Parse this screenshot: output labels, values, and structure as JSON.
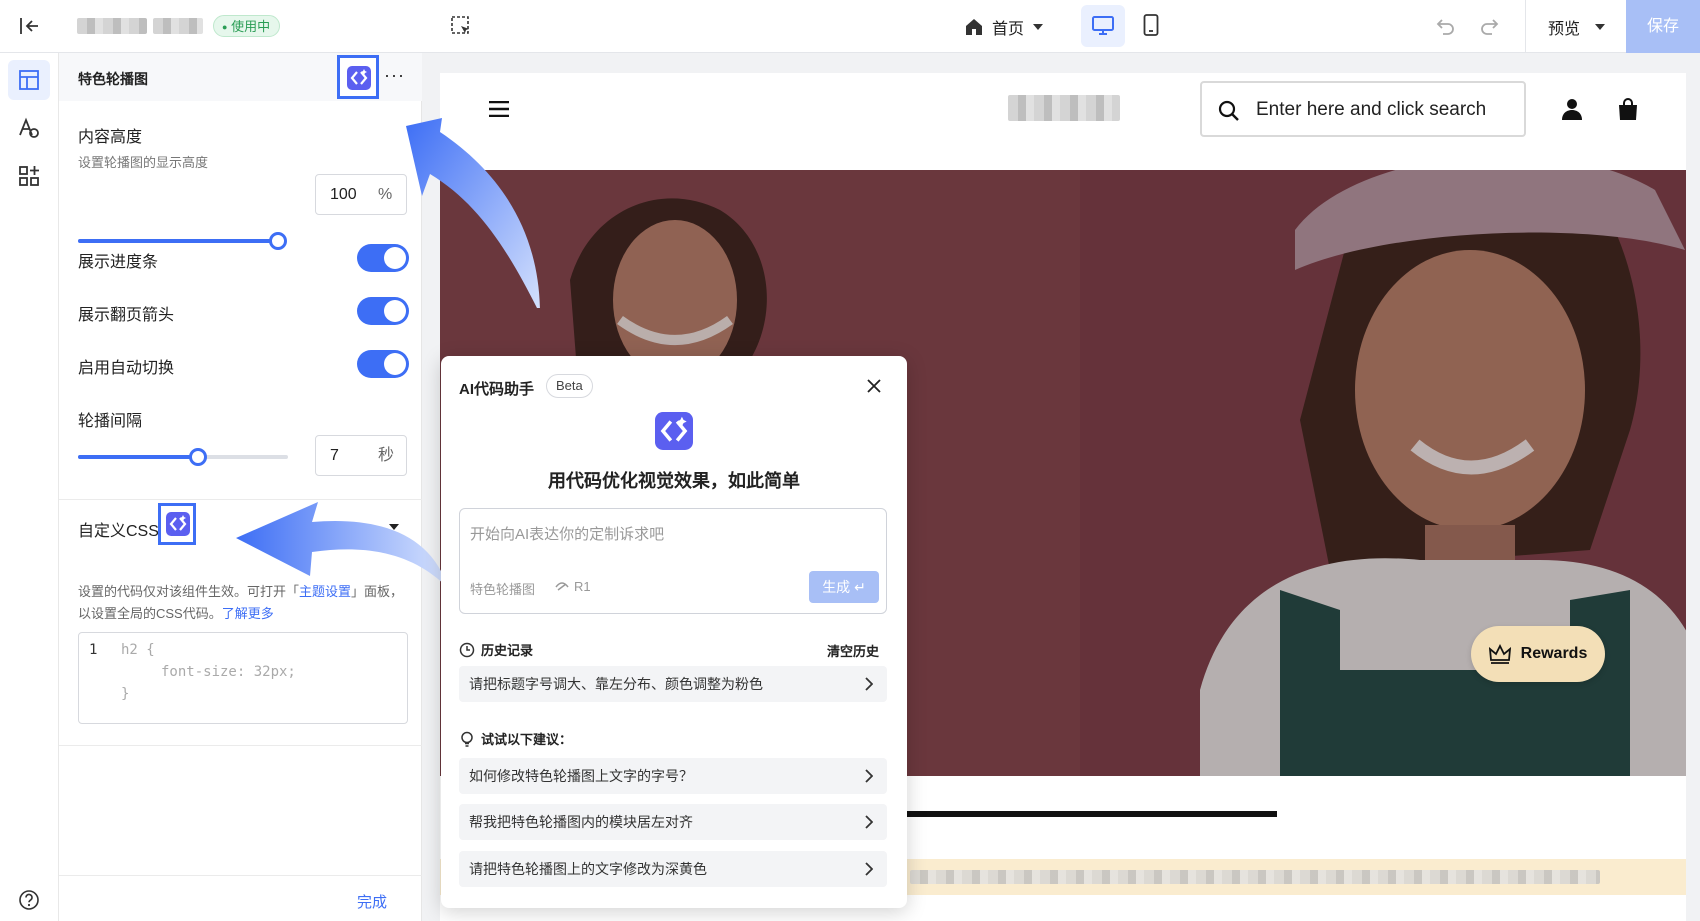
{
  "topbar": {
    "status_badge": "使用中",
    "page_select": "首页",
    "preview_label": "预览",
    "save_label": "保存"
  },
  "panel": {
    "section_title": "特色轮播图",
    "more": "···",
    "height_label": "内容高度",
    "height_desc": "设置轮播图的显示高度",
    "height_value": "100",
    "height_unit": "%",
    "height_slider_fraction": 1.0,
    "show_progress": "展示进度条",
    "show_arrows": "展示翻页箭头",
    "auto_switch": "启用自动切换",
    "interval_label": "轮播间隔",
    "interval_value": "7",
    "interval_unit": "秒",
    "interval_slider_fraction": 0.57,
    "css_title": "自定义CSS",
    "css_desc_1": "设置的代码仅对该组件生效。可打开「",
    "css_desc_link1": "主题设置",
    "css_desc_2": "」面板，以设置全局的CSS代码。",
    "css_desc_link2": "了解更多",
    "code_line_no": "1",
    "code_1": "h2 {",
    "code_2": "font-size: 32px;",
    "code_3": "}",
    "done": "完成"
  },
  "store": {
    "search_placeholder": "Enter here and click search",
    "rewards": "Rewards"
  },
  "ai": {
    "title": "AI代码助手",
    "beta": "Beta",
    "headline": "用代码优化视觉效果，如此简单",
    "input_placeholder": "开始向AI表达你的定制诉求吧",
    "context_tag": "特色轮播图",
    "model_tag": "R1",
    "generate": "生成 ↵",
    "history_title": "历史记录",
    "clear_history": "清空历史",
    "history_items": [
      "请把标题字号调大、靠左分布、颜色调整为粉色"
    ],
    "suggest_title": "试试以下建议：",
    "suggestions": [
      "如何修改特色轮播图上文字的字号？",
      "帮我把特色轮播图内的模块居左对齐",
      "请把特色轮播图上的文字修改为深黄色"
    ]
  },
  "colors": {
    "accent": "#3d6ef5",
    "save_bg": "#a8bff6",
    "badge_bg": "#e6f7ec",
    "badge_fg": "#2a9d55",
    "hero_bg": "#8a4a52",
    "rewards_bg": "#f3dfb7",
    "banner_bg": "#faeccf"
  }
}
